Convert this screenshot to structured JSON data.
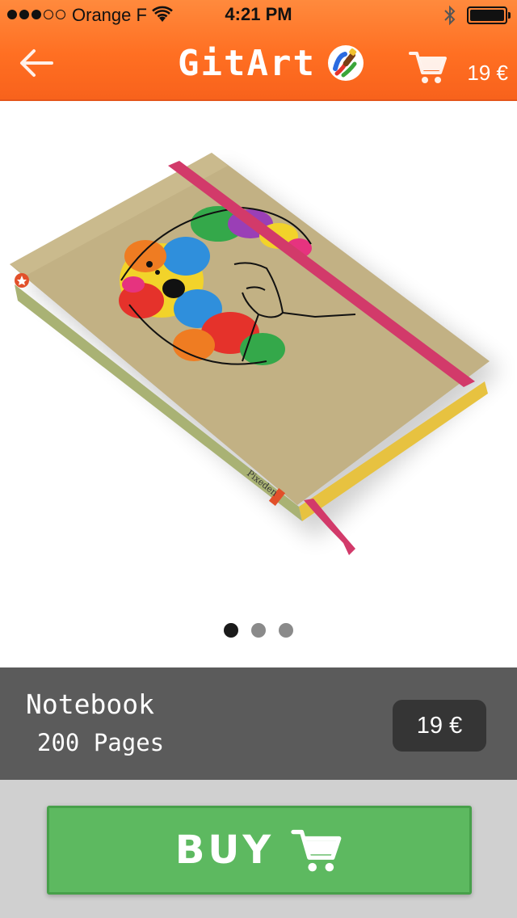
{
  "status_bar": {
    "carrier": "Orange F",
    "time": "4:21 PM",
    "signal_icon": "signal-dots-icon",
    "wifi_icon": "wifi-icon",
    "bluetooth_icon": "bluetooth-icon",
    "battery_icon": "battery-icon"
  },
  "nav": {
    "back_icon": "arrow-left-icon",
    "title": "GitArt",
    "logo_icon": "paint-brush-logo-icon",
    "cart_icon": "shopping-cart-icon",
    "cart_total": "19 €"
  },
  "product": {
    "image_description_icon": "notebook-product-image",
    "name": "Notebook",
    "detail": "200 Pages",
    "price": "19 €",
    "carousel": {
      "count": 3,
      "active_index": 0
    }
  },
  "buy": {
    "label": "BUY",
    "icon": "shopping-cart-icon"
  },
  "colors": {
    "header_orange": "#ff6f22",
    "info_bar_gray": "#5b5b5b",
    "price_badge": "#353535",
    "buy_green": "#5db960",
    "buy_area_gray": "#d0d0d0"
  }
}
